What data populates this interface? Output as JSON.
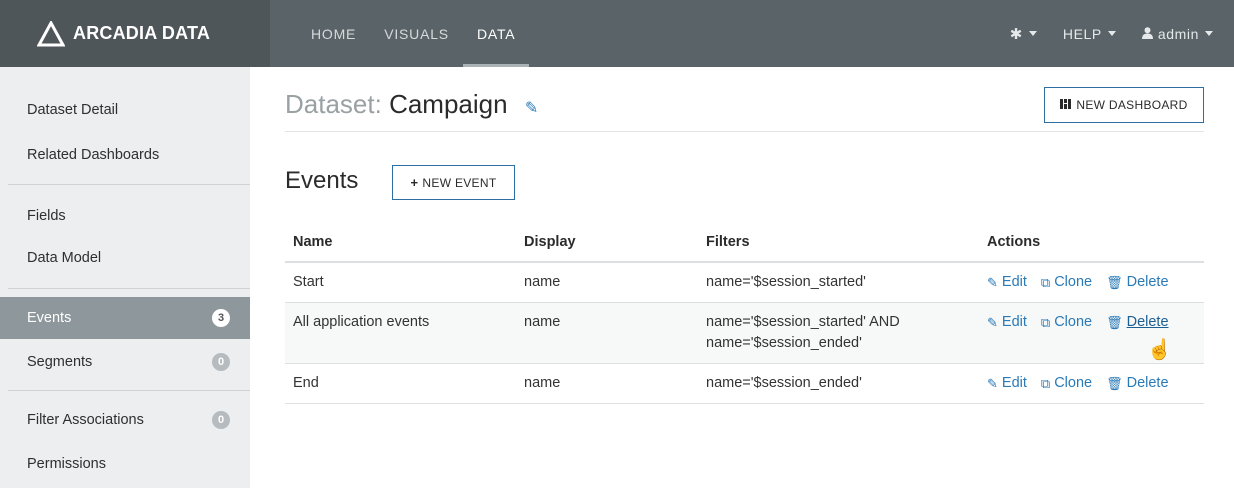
{
  "brand": {
    "name": "ARCADIA DATA"
  },
  "nav": {
    "links": [
      "HOME",
      "VISUALS",
      "DATA"
    ],
    "active": "DATA",
    "help_label": "HELP",
    "user_label": "admin"
  },
  "sidebar": {
    "items": [
      {
        "label": "Dataset Detail"
      },
      {
        "label": "Related Dashboards"
      },
      {
        "label": "Fields"
      },
      {
        "label": "Data Model"
      },
      {
        "label": "Events",
        "badge": "3",
        "active": true
      },
      {
        "label": "Segments",
        "badge": "0"
      },
      {
        "label": "Filter Associations",
        "badge": "0"
      },
      {
        "label": "Permissions"
      }
    ]
  },
  "page": {
    "title_prefix": "Dataset:",
    "title": "Campaign",
    "new_dashboard_label": "NEW DASHBOARD"
  },
  "events": {
    "section_title": "Events",
    "new_event_label": "NEW EVENT",
    "columns": [
      "Name",
      "Display",
      "Filters",
      "Actions"
    ],
    "rows": [
      {
        "name": "Start",
        "display": "name",
        "filters": [
          "name='$session_started'"
        ]
      },
      {
        "name": "All application events",
        "display": "name",
        "filters": [
          "name='$session_started' AND",
          "name='$session_ended'"
        ]
      },
      {
        "name": "End",
        "display": "name",
        "filters": [
          "name='$session_ended'"
        ]
      }
    ],
    "actions": {
      "edit": "Edit",
      "clone": "Clone",
      "delete": "Delete"
    }
  },
  "colors": {
    "navbar": "#5a6367",
    "sidebar": "#eceeef",
    "sidebar_active": "#8e979b",
    "link": "#2a7ab7"
  }
}
